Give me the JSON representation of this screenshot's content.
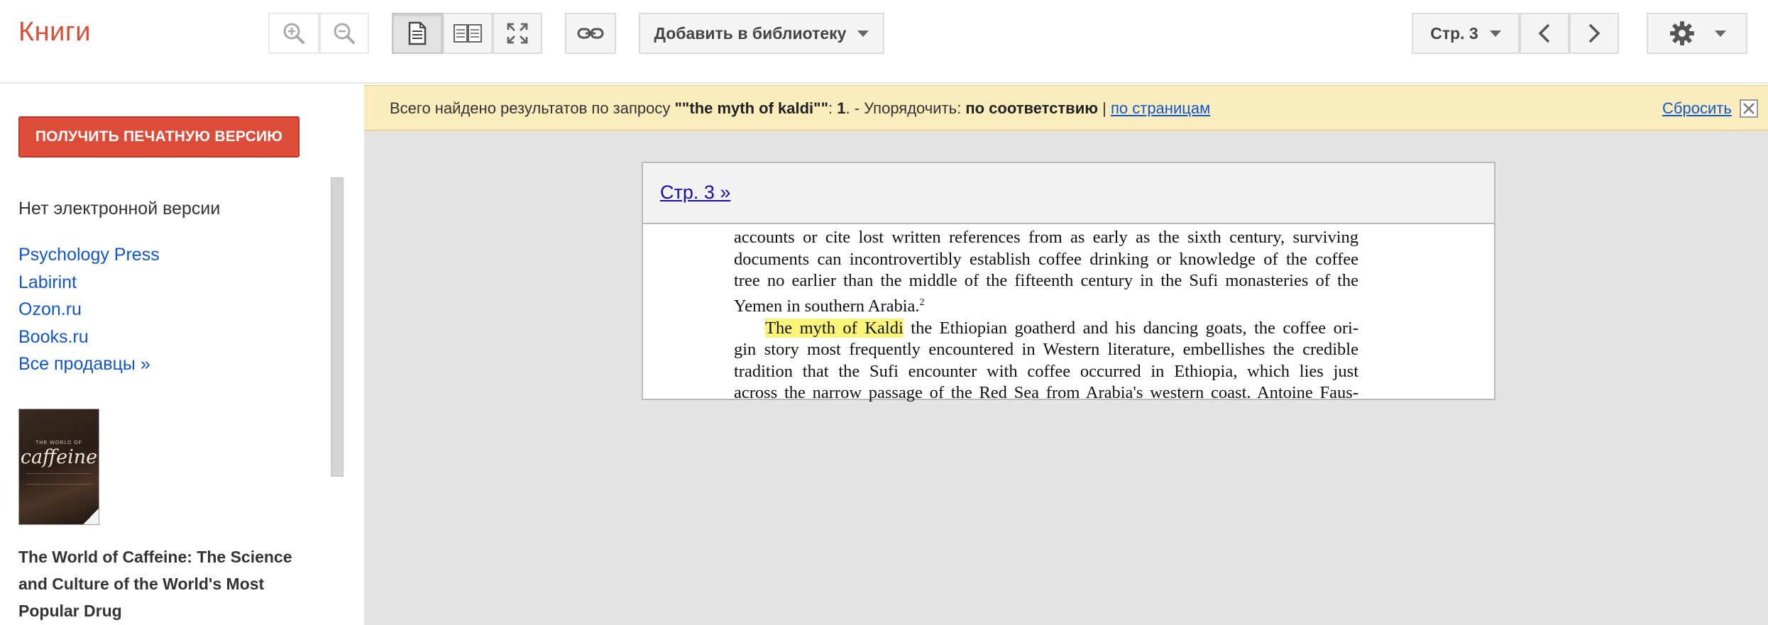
{
  "app": {
    "title": "Книги"
  },
  "toolbar": {
    "zoom_in_icon": "zoom-in-icon",
    "zoom_out_icon": "zoom-out-icon",
    "add_library_label": "Добавить в библиотеку",
    "page_selector_label": "Стр. 3"
  },
  "sidebar": {
    "get_print_label": "ПОЛУЧИТЬ ПЕЧАТНУЮ ВЕРСИЮ",
    "no_ebook": "Нет электронной версии",
    "sellers": [
      "Psychology Press",
      "Labirint",
      "Ozon.ru",
      "Books.ru",
      "Все продавцы »"
    ],
    "cover": {
      "top_text": "THE WORLD OF",
      "title": "caffeine"
    },
    "book_title": "The World of Caffeine: The Science and Culture of the World's Most Popular Drug"
  },
  "search": {
    "prefix": "Всего найдено результатов по запросу ",
    "query": "\"\"the myth of kaldi\"\"",
    "colon": ": ",
    "count": "1",
    "after_count": ". - Упорядочить: ",
    "sort_active": "по соответствию",
    "separator": " | ",
    "sort_other": "по страницам",
    "reset_label": "Сбросить"
  },
  "result": {
    "page_link": "Стр. 3 »",
    "lines": [
      "accounts or cite lost written references from as early as the sixth century, surviving",
      "documents can incontrovertibly establish coffee drinking or knowledge of the coffee",
      "tree no earlier than the middle of the fifteenth century in the Sufi monasteries of the",
      "Yemen in southern Arabia.",
      "the Ethiopian goatherd and his dancing goats, the coffee ori-",
      "gin story most frequently encountered in Western literature, embellishes the credible",
      "tradition that the Sufi encounter with coffee occurred in Ethiopia, which lies just",
      "across the narrow passage of the Red Sea from Arabia's western coast. Antoine Faus-"
    ],
    "footnote": "2",
    "highlight": "The myth of Kaldi"
  },
  "colors": {
    "brand": "#dd4b39",
    "link": "#1155cc",
    "notice_bg": "#f9edbe",
    "highlight": "#fbf67a"
  }
}
